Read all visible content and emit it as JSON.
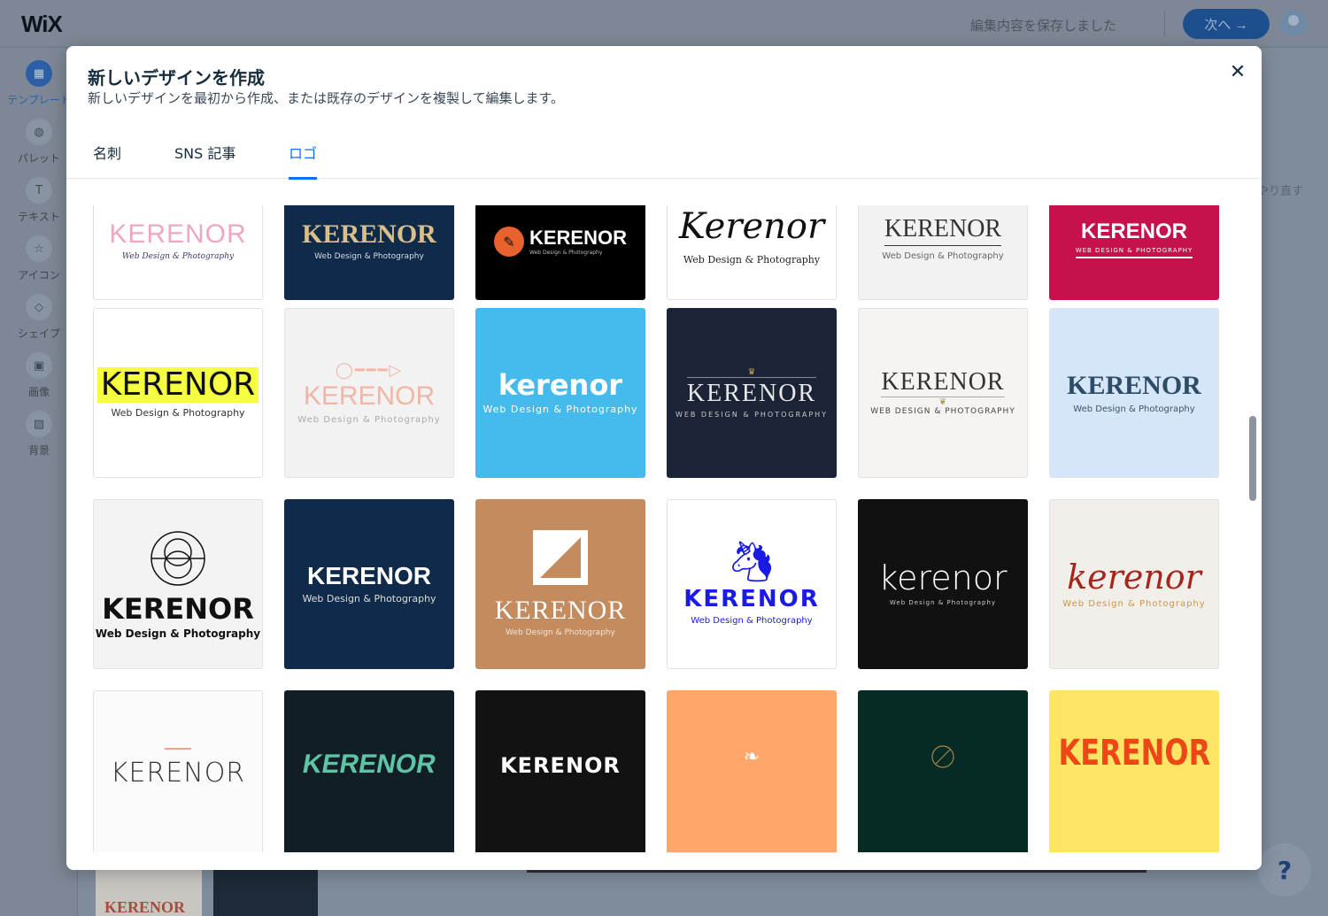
{
  "app": {
    "logo": "WiX",
    "saved_text": "編集内容を保存しました",
    "next_label": "次へ →",
    "redo_label": "やり直す",
    "help_label": "?",
    "bg_thumb_text": "KERENOR"
  },
  "sidebar": {
    "items": [
      {
        "label": "テンプレート",
        "icon": "template-icon",
        "glyph": "▦"
      },
      {
        "label": "パレット",
        "icon": "palette-icon",
        "glyph": "◍"
      },
      {
        "label": "テキスト",
        "icon": "text-icon",
        "glyph": "T"
      },
      {
        "label": "アイコン",
        "icon": "star-icon",
        "glyph": "☆"
      },
      {
        "label": "シェイプ",
        "icon": "shape-icon",
        "glyph": "◇"
      },
      {
        "label": "画像",
        "icon": "image-icon",
        "glyph": "▣"
      },
      {
        "label": "背景",
        "icon": "background-icon",
        "glyph": "▨"
      }
    ]
  },
  "modal": {
    "title": "新しいデザインを作成",
    "subtitle": "新しいデザインを最初から作成、または既存のデザインを複製して編集します。",
    "close_label": "✕",
    "tabs": [
      {
        "label": "名刺"
      },
      {
        "label": "SNS 記事"
      },
      {
        "label": "ロゴ"
      }
    ],
    "active_tab": "ロゴ"
  },
  "logos": [
    {
      "name": "KERENOR",
      "sub": "Web Design & Photography"
    },
    {
      "name": "KERENOR",
      "sub": "Web Design & Photography"
    },
    {
      "name": "KERENOR",
      "sub": "Web Design & Photography"
    },
    {
      "name": "Kerenor",
      "sub": "Web Design & Photography"
    },
    {
      "name": "KERENOR",
      "sub": "Web Design & Photography"
    },
    {
      "name": "KERENOR",
      "sub": "WEB DESIGN & PHOTOGRAPHY"
    },
    {
      "name": "KERENOR",
      "sub": "Web Design & Photography"
    },
    {
      "name": "KERENOR",
      "sub": "Web Design & Photography"
    },
    {
      "name": "kerenor",
      "sub": "Web Design & Photography"
    },
    {
      "name": "KERENOR",
      "sub": "WEB DESIGN & PHOTOGRAPHY"
    },
    {
      "name": "KERENOR",
      "sub": "WEB DESIGN & PHOTOGRAPHY"
    },
    {
      "name": "KERENOR",
      "sub": "Web Design & Photography"
    },
    {
      "name": "KERENOR",
      "sub": "Web Design & Photography"
    },
    {
      "name": "KERENOR",
      "sub": "Web Design & Photography"
    },
    {
      "name": "KERENOR",
      "sub": "Web Design & Photography"
    },
    {
      "name": "KERENOR",
      "sub": "Web Design & Photography"
    },
    {
      "name": "kerenor",
      "sub": "Web Design & Photography"
    },
    {
      "name": "kerenor",
      "sub": "Web Design & Photography"
    },
    {
      "name": "KERENOR",
      "sub": ""
    },
    {
      "name": "KERENOR",
      "sub": ""
    },
    {
      "name": "KERENOR",
      "sub": ""
    },
    {
      "name": "",
      "sub": ""
    },
    {
      "name": "",
      "sub": ""
    },
    {
      "name": "KERENOR",
      "sub": ""
    }
  ],
  "colors": {
    "accent": "#116dff",
    "modal_bg": "#ffffff",
    "overlay": "#7f8c9b"
  }
}
